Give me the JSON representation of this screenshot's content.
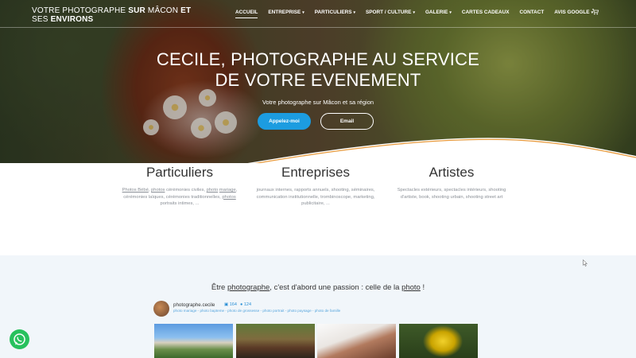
{
  "brand": {
    "line1_a": "VOTRE PHOTOGRAPHE ",
    "line1_b": "SUR",
    "line1_c": " MÂCON ",
    "line1_d": "ET",
    "line2": "SES ",
    "line2_b": "ENVIRONS"
  },
  "nav": [
    {
      "label": "ACCUEIL",
      "active": true,
      "dropdown": false
    },
    {
      "label": "ENTREPRISE",
      "dropdown": true
    },
    {
      "label": "PARTICULIERS",
      "dropdown": true
    },
    {
      "label": "SPORT / CULTURE",
      "dropdown": true
    },
    {
      "label": "GALERIE",
      "dropdown": true
    },
    {
      "label": "CARTES CADEAUX",
      "dropdown": false
    },
    {
      "label": "CONTACT",
      "dropdown": false
    },
    {
      "label": "AVIS GOOGLE",
      "dropdown": true
    }
  ],
  "hero": {
    "title_line1": "CECILE, PHOTOGRAPHE AU SERVICE",
    "title_line2": "DE VOTRE EVENEMENT",
    "subtitle": "Votre photographe sur Mâcon et sa région",
    "call_button": "Appelez-moi",
    "email_button": "Email"
  },
  "services": [
    {
      "title": "Particuliers",
      "text_parts": [
        "Photos Bébé",
        ", ",
        "photos",
        " cérémonies civiles, ",
        "photo",
        " ",
        "mariage",
        ", cérémonies laïques, cérémonies traditionnelles, ",
        "photos",
        " portraits intimes, ..."
      ]
    },
    {
      "title": "Entreprises",
      "text": "journaux internes, rapports annuels, shooting, séminaires, communication institutionnelle, trombinoscope, marketing, publicitaire, ..."
    },
    {
      "title": "Artistes",
      "text": "Spectacles extérieurs, spectacles intérieurs, shooting d'artiste, book, shooting urbain, shooting street art"
    }
  ],
  "passion": {
    "a": "Être ",
    "b": "photographe",
    "c": ", c'est d'abord une passion : celle de la ",
    "d": "photo",
    "e": "  !"
  },
  "instagram": {
    "username": "photographe.cecile",
    "posts": "164",
    "followers": "124",
    "tags": "photo mariage - photo bapteme - photo de grossesse - photo portrait - photo paysage - photo de famille"
  },
  "colors": {
    "accent": "#1c9ce0",
    "wave_orange": "#e89a3c",
    "whatsapp": "#27c15d"
  }
}
